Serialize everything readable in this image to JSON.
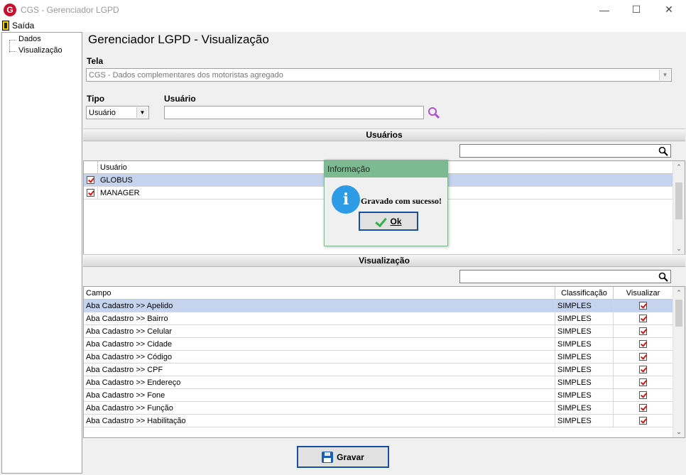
{
  "window": {
    "title": "CGS - Gerenciador LGPD",
    "logo_letter": "G",
    "minimize": "—",
    "maximize": "☐",
    "close": "✕"
  },
  "menu": {
    "exit_label": "Saída"
  },
  "tree": {
    "items": [
      "Dados",
      "Visualização"
    ]
  },
  "page": {
    "title": "Gerenciador LGPD - Visualização",
    "tela_label": "Tela",
    "tela_value": "CGS - Dados complementares dos motoristas agregado",
    "tipo_label": "Tipo",
    "tipo_value": "Usuário",
    "usuario_label": "Usuário",
    "usuario_value": ""
  },
  "usuarios_section": {
    "title": "Usuários",
    "search_value": "",
    "column": "Usuário",
    "rows": [
      {
        "checked": true,
        "name": "GLOBUS",
        "selected": true
      },
      {
        "checked": true,
        "name": "MANAGER",
        "selected": false
      }
    ]
  },
  "visualizacao_section": {
    "title": "Visualização",
    "search_value": "",
    "columns": [
      "Campo",
      "Classificação",
      "Visualizar"
    ],
    "rows": [
      {
        "campo": "Aba Cadastro >> Apelido",
        "classificacao": "SIMPLES",
        "visualizar": true,
        "selected": true
      },
      {
        "campo": "Aba Cadastro >> Bairro",
        "classificacao": "SIMPLES",
        "visualizar": true
      },
      {
        "campo": "Aba Cadastro >> Celular",
        "classificacao": "SIMPLES",
        "visualizar": true
      },
      {
        "campo": "Aba Cadastro >> Cidade",
        "classificacao": "SIMPLES",
        "visualizar": true
      },
      {
        "campo": "Aba Cadastro >> Código",
        "classificacao": "SIMPLES",
        "visualizar": true
      },
      {
        "campo": "Aba Cadastro >> CPF",
        "classificacao": "SIMPLES",
        "visualizar": true
      },
      {
        "campo": "Aba Cadastro >> Endereço",
        "classificacao": "SIMPLES",
        "visualizar": true
      },
      {
        "campo": "Aba Cadastro >> Fone",
        "classificacao": "SIMPLES",
        "visualizar": true
      },
      {
        "campo": "Aba Cadastro >> Função",
        "classificacao": "SIMPLES",
        "visualizar": true
      },
      {
        "campo": "Aba Cadastro >> Habilitação",
        "classificacao": "SIMPLES",
        "visualizar": true
      }
    ]
  },
  "buttons": {
    "gravar": "Gravar"
  },
  "dialog": {
    "title": "Informação",
    "message": "Gravado com sucesso!",
    "icon_letter": "i",
    "ok_label": "Ok"
  },
  "colors": {
    "dialog_title_bg": "#7dba92",
    "selected_row": "#c5d3ef",
    "button_border": "#1a4fa0",
    "check_red": "#e01010"
  }
}
